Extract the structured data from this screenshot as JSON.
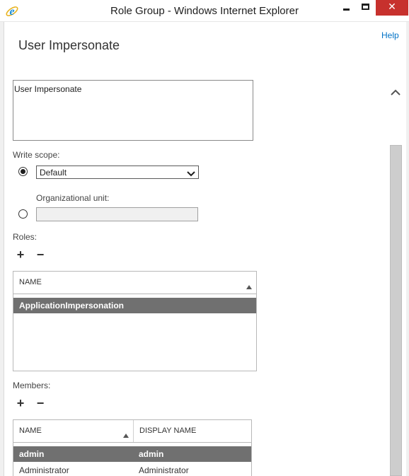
{
  "window": {
    "title": "Role Group - Windows Internet Explorer",
    "close_glyph": "✕"
  },
  "header": {
    "help_label": "Help",
    "page_title": "User Impersonate"
  },
  "form": {
    "description_value": "User Impersonate",
    "write_scope_label": "Write scope:",
    "write_scope_selected": "Default",
    "write_scope_radio_checked": true,
    "ou_label": "Organizational unit:",
    "ou_value": "",
    "ou_radio_checked": false
  },
  "roles": {
    "label": "Roles:",
    "add_glyph": "+",
    "remove_glyph": "−",
    "columns": [
      "NAME"
    ],
    "sort_direction": "ascending",
    "rows": [
      {
        "name": "ApplicationImpersonation",
        "selected": true
      }
    ]
  },
  "members": {
    "label": "Members:",
    "add_glyph": "+",
    "remove_glyph": "−",
    "columns": [
      "NAME",
      "DISPLAY NAME"
    ],
    "sort_direction": "ascending",
    "rows": [
      {
        "name": "admin",
        "display_name": "admin",
        "selected": true
      },
      {
        "name": "Administrator",
        "display_name": "Administrator",
        "selected": false
      }
    ]
  },
  "icons": {
    "app_icon": "internet-explorer-icon",
    "minimize": "minimize-icon",
    "maximize": "maximize-icon",
    "close": "close-icon",
    "scroll_up": "chevron-up-icon",
    "dropdown": "chevron-down-icon",
    "sort": "sort-ascending-icon"
  },
  "colors": {
    "link": "#0072c6",
    "close_button": "#c7312d",
    "selected_row": "#707070",
    "ie_blue": "#1e90d8",
    "ie_gold": "#e8b320"
  }
}
